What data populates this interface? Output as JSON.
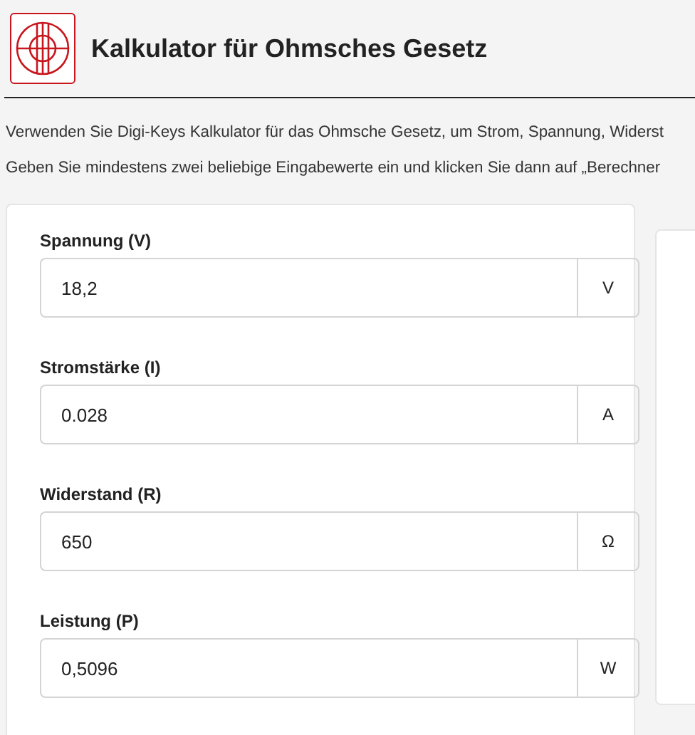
{
  "header": {
    "title": "Kalkulator für Ohmsches Gesetz"
  },
  "intro": [
    "Verwenden Sie Digi-Keys Kalkulator für das Ohmsche Gesetz, um Strom, Spannung, Widerst",
    "Geben Sie mindestens zwei beliebige Eingabewerte ein und klicken Sie dann auf „Berechner"
  ],
  "fields": [
    {
      "label": "Spannung (V)",
      "value": "18,2",
      "unit": "V"
    },
    {
      "label": "Stromstärke (I)",
      "value": "0.028",
      "unit": "A"
    },
    {
      "label": "Widerstand (R)",
      "value": "650",
      "unit": "Ω"
    },
    {
      "label": "Leistung (P)",
      "value": "0,5096",
      "unit": "W"
    }
  ]
}
